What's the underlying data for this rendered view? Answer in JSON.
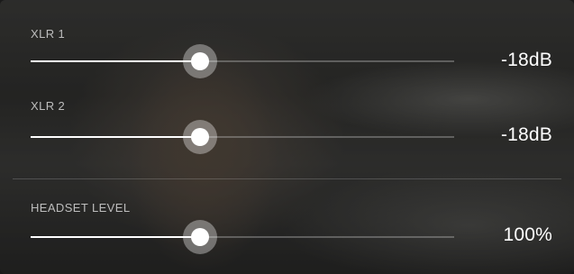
{
  "sliders": [
    {
      "label": "XLR 1",
      "value_text": "-18dB",
      "level": 0.4
    },
    {
      "label": "XLR 2",
      "value_text": "-18dB",
      "level": 0.4
    },
    {
      "label": "HEADSET LEVEL",
      "value_text": "100%",
      "level": 0.4
    }
  ],
  "colors": {
    "accent": "#ffffff",
    "label": "#bdbdbd",
    "track": "#c8c8c8"
  }
}
